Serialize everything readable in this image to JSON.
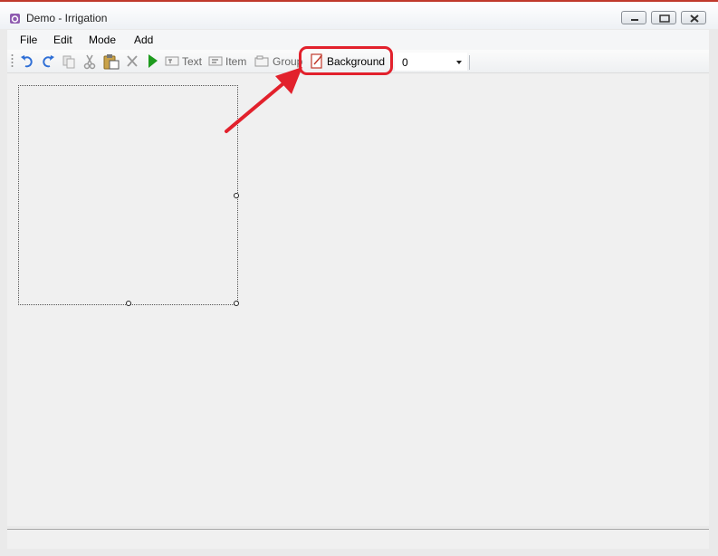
{
  "window": {
    "title": "Demo - Irrigation"
  },
  "menu": [
    "File",
    "Edit",
    "Mode",
    "Add"
  ],
  "toolbar": {
    "icons": {
      "undo": "undo-icon",
      "redo": "redo-icon",
      "copy": "copy-icon",
      "cut": "cut-icon",
      "paste": "paste-icon",
      "delete": "delete-icon",
      "run": "play-icon"
    },
    "text_label": "Text",
    "item_label": "Item",
    "group_label": "Group",
    "background_label": "Background",
    "combo_value": "0"
  },
  "colors": {
    "annotation": "#e2212c",
    "run": "#1e9b1e",
    "accent_frame": "#c0392b"
  }
}
